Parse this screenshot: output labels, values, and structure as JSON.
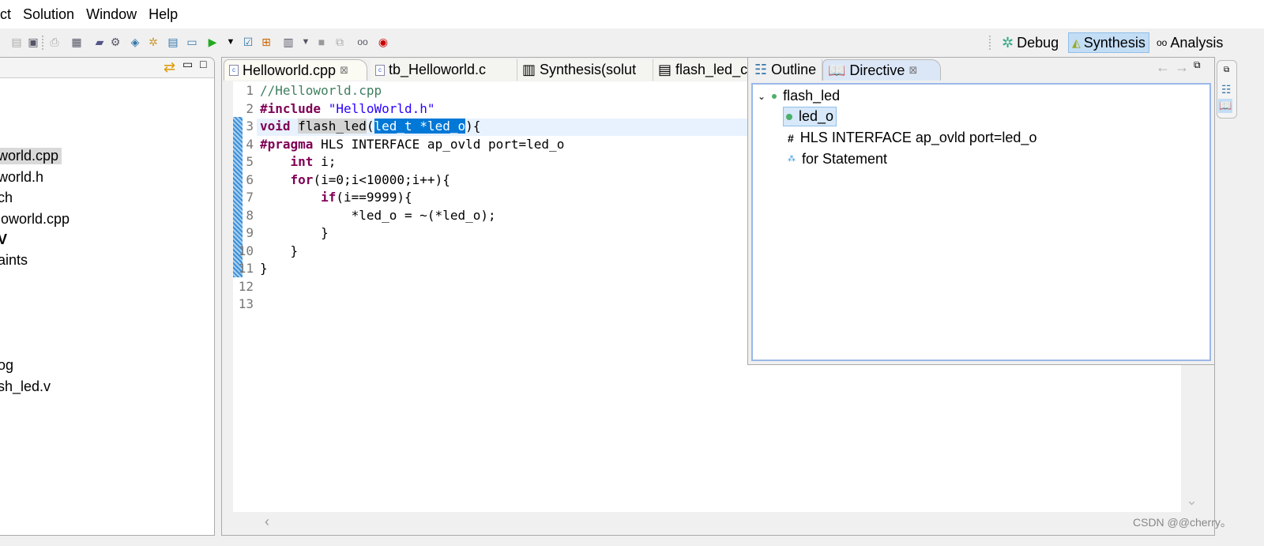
{
  "menu": [
    "ct",
    "Solution",
    "Window",
    "Help"
  ],
  "perspectives": {
    "debug": "Debug",
    "synthesis": "Synthesis",
    "analysis": "Analysis"
  },
  "explorer": {
    "items": [
      "world.cpp",
      "world.h",
      "ch",
      "loworld.cpp",
      "V",
      "aints",
      "og",
      "sh_led.v"
    ]
  },
  "editor": {
    "tabs": [
      "Helloworld.cpp",
      "tb_Helloworld.c",
      "Synthesis(solut",
      "flash_led_cs"
    ],
    "close_glyph": "⊠",
    "lines": [
      [
        [
          "//Helloworld.cpp",
          "c"
        ]
      ],
      [
        [
          "#include",
          "k"
        ],
        [
          " ",
          ""
        ],
        [
          "\"HelloWorld.h\"",
          "s"
        ]
      ],
      [
        [
          "void",
          "k"
        ],
        [
          " ",
          ""
        ],
        [
          "flash_led",
          "hl"
        ],
        [
          "(",
          ""
        ],
        [
          "led_t *led_o",
          "sel"
        ],
        [
          "){",
          ""
        ]
      ],
      [
        [
          "#pragma",
          "k"
        ],
        [
          " HLS INTERFACE ap_ovld port=led_o",
          ""
        ]
      ],
      [
        [
          "    ",
          ""
        ],
        [
          "int",
          "k"
        ],
        [
          " i;",
          ""
        ]
      ],
      [
        [
          "    ",
          ""
        ],
        [
          "for",
          "k"
        ],
        [
          "(i=0;i<10000;i++){",
          ""
        ]
      ],
      [
        [
          "        ",
          ""
        ],
        [
          "if",
          "k"
        ],
        [
          "(i==9999){",
          ""
        ]
      ],
      [
        [
          "            *led_o = ~(*led_o);",
          ""
        ]
      ],
      [
        [
          "        }",
          ""
        ]
      ],
      [
        [
          "    }",
          ""
        ]
      ],
      [
        [
          "}",
          ""
        ]
      ],
      [],
      []
    ]
  },
  "directive": {
    "tabs": [
      "Outline",
      "Directive"
    ],
    "tree": {
      "root": "flash_led",
      "children": [
        "led_o",
        "HLS INTERFACE ap_ovld port=led_o",
        "for Statement"
      ],
      "selected": "led_o"
    }
  },
  "watermark": "CSDN @@cherry。"
}
